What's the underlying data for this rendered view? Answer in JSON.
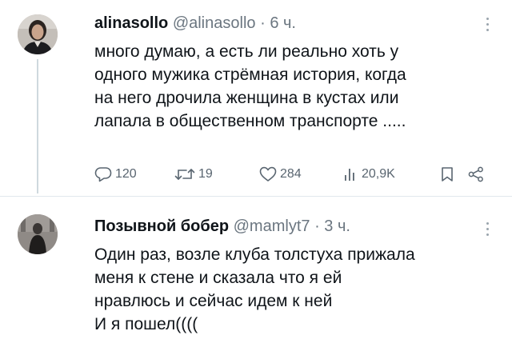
{
  "tweets": [
    {
      "name": "alinasollo",
      "handle": "@alinasollo",
      "separator": "·",
      "time": "6 ч.",
      "lines": [
        "много думаю, а есть ли реально хоть у",
        "одного мужика стрёмная история, когда",
        "на него дрочила женщина в кустах или",
        "лапала в общественном транспорте ....."
      ],
      "actions": {
        "replies": "120",
        "retweets": "19",
        "likes": "284",
        "views": "20,9K"
      }
    },
    {
      "name": "Позывной бобер",
      "handle": "@mamlyt7",
      "separator": "·",
      "time": "3 ч.",
      "lines": [
        "Один раз, возле клуба толстуха прижала",
        "меня к стене и сказала что я ей",
        "нравлюсь и сейчас идем к ней",
        "И я пошел(((("
      ]
    }
  ],
  "icons": {
    "reply": "reply-icon",
    "retweet": "retweet-icon",
    "like": "heart-icon",
    "views": "views-icon",
    "bookmark": "bookmark-icon",
    "share": "share-icon",
    "more": "more-vertical-icon"
  },
  "colors": {
    "text": "#0f1419",
    "secondary": "#6b7680",
    "action": "#596570",
    "thread_line": "#cfd9de"
  }
}
